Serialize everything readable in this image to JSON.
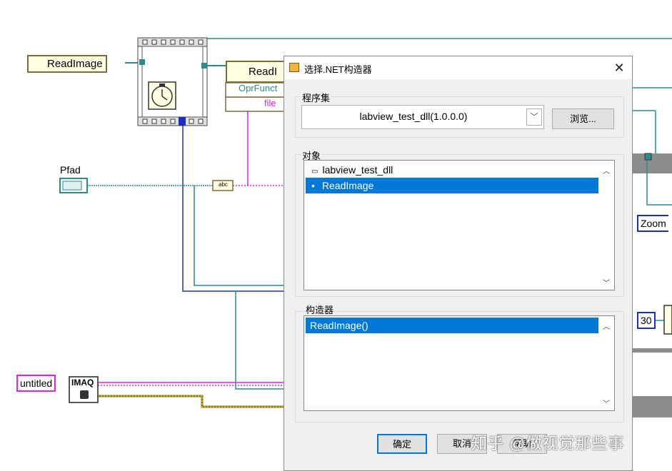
{
  "diagram": {
    "readimage_node_label": "ReadImage",
    "readimage_node2_label": "ReadI",
    "opr_func_label": "OprFunct",
    "file_label": "file",
    "pfad_label": "Pfad",
    "abc_label": "abc",
    "untitled_label": "untitled",
    "imaq_label": "IMAQ",
    "zoom_label": "Zoom",
    "thirty_label": "30"
  },
  "dialog": {
    "title": "选择.NET构造器",
    "close_glyph": "✕",
    "assembly_group_label": "程序集",
    "assembly_value": "labview_test_dll(1.0.0.0)",
    "browse_label": "浏览...",
    "object_group_label": "对象",
    "objects": [
      {
        "label": "labview_test_dll",
        "prefix": "▭",
        "selected": false
      },
      {
        "label": "ReadImage",
        "prefix": "•",
        "selected": true
      }
    ],
    "constructor_group_label": "构造器",
    "constructors": [
      {
        "label": "ReadImage()",
        "selected": true
      }
    ],
    "ok_label": "确定",
    "cancel_label": "取消",
    "help_label": "帮助"
  },
  "watermark": "知乎 @做视觉那些事",
  "colors": {
    "accent": "#0078d7",
    "wire_teal": "#2a8c8c",
    "wire_blue": "#1c2fbf",
    "wire_pink": "#e61ee6",
    "wire_yellow": "#8c7a10"
  }
}
